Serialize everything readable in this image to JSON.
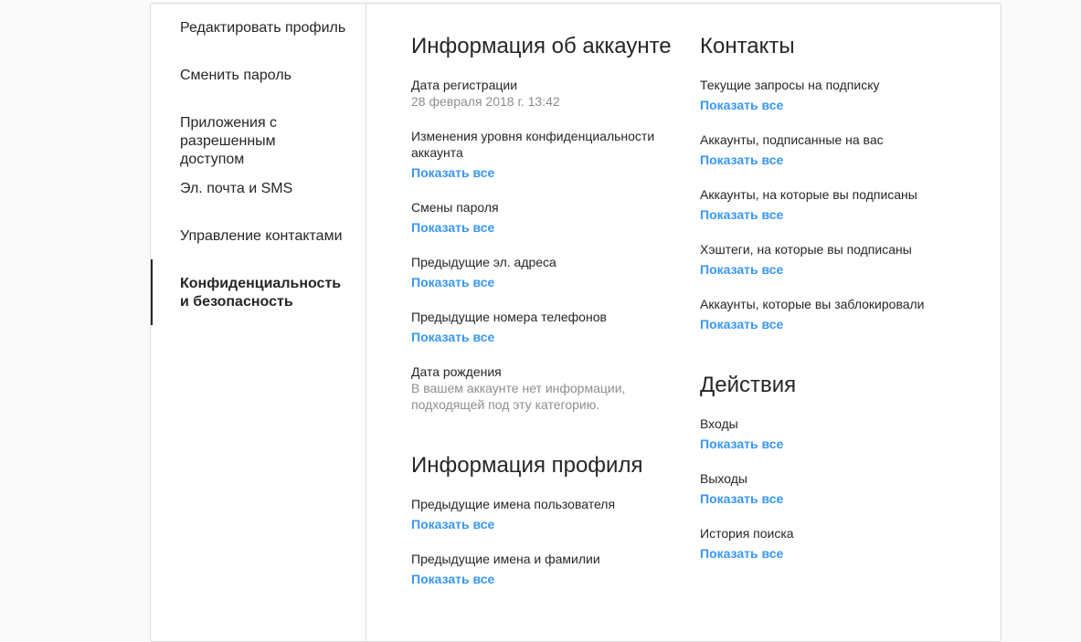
{
  "sidebar": {
    "items": [
      {
        "label": "Редактировать профиль"
      },
      {
        "label": "Сменить пароль"
      },
      {
        "label": "Приложения с разрешенным доступом"
      },
      {
        "label": "Эл. почта и SMS"
      },
      {
        "label": "Управление контактами"
      },
      {
        "label": "Конфиденциальность и безопасность",
        "active": true
      }
    ]
  },
  "account_info": {
    "title": "Информация об аккаунте",
    "registration_date": {
      "label": "Дата регистрации",
      "value": "28 февраля 2018 г. 13:42"
    },
    "privacy_changes": {
      "label": "Изменения уровня конфиденциальности аккаунта",
      "link": "Показать все"
    },
    "password_changes": {
      "label": "Смены пароля",
      "link": "Показать все"
    },
    "former_emails": {
      "label": "Предыдущие эл. адреса",
      "link": "Показать все"
    },
    "former_phones": {
      "label": "Предыдущие номера телефонов",
      "link": "Показать все"
    },
    "birthday": {
      "label": "Дата рождения",
      "value": "В вашем аккаунте нет информации, подходящей под эту категорию."
    }
  },
  "profile_info": {
    "title": "Информация профиля",
    "former_usernames": {
      "label": "Предыдущие имена пользователя",
      "link": "Показать все"
    },
    "former_names": {
      "label": "Предыдущие имена и фамилии",
      "link": "Показать все"
    }
  },
  "contacts": {
    "title": "Контакты",
    "follow_requests": {
      "label": "Текущие запросы на подписку",
      "link": "Показать все"
    },
    "followers": {
      "label": "Аккаунты, подписанные на вас",
      "link": "Показать все"
    },
    "following": {
      "label": "Аккаунты, на которые вы подписаны",
      "link": "Показать все"
    },
    "hashtags": {
      "label": "Хэштеги, на которые вы подписаны",
      "link": "Показать все"
    },
    "blocked": {
      "label": "Аккаунты, которые вы заблокировали",
      "link": "Показать все"
    }
  },
  "activity": {
    "title": "Действия",
    "logins": {
      "label": "Входы",
      "link": "Показать все"
    },
    "logouts": {
      "label": "Выходы",
      "link": "Показать все"
    },
    "search_history": {
      "label": "История поиска",
      "link": "Показать все"
    }
  },
  "colors": {
    "link": "#3897f0",
    "text": "#262626",
    "muted": "#8e8e8e",
    "border": "#dbdbdb"
  }
}
